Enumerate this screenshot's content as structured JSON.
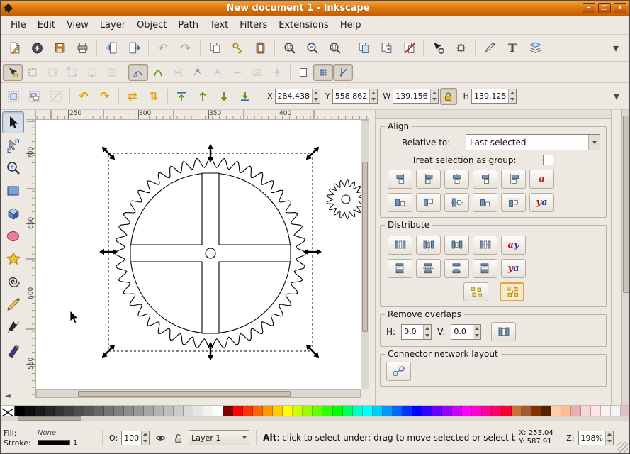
{
  "window": {
    "title": "New document 1 - Inkscape",
    "btn_min": "–",
    "btn_max": "□",
    "btn_close": "×"
  },
  "menubar": [
    "File",
    "Edit",
    "View",
    "Layer",
    "Object",
    "Path",
    "Text",
    "Filters",
    "Extensions",
    "Help"
  ],
  "glyphs": {
    "undo": "↶",
    "redo": "↷",
    "chevron": "▾",
    "rotate_ccw": "↶",
    "rotate_cw": "↷",
    "flip_h": "⇄",
    "flip_v": "⇅",
    "text_tool": "T",
    "collapse": "◄"
  },
  "controls": {
    "x_label": "X",
    "x_value": "284.438",
    "y_label": "Y",
    "y_value": "558.862",
    "w_label": "W",
    "w_value": "139.156",
    "h_label": "H",
    "h_value": "139.125"
  },
  "rulers": {
    "top": [
      "250",
      "300",
      "350",
      "400"
    ],
    "left": [
      "700",
      "650",
      "600",
      "550"
    ]
  },
  "dock": {
    "align": {
      "title": "Align",
      "relative_label": "Relative to:",
      "relative_value": "Last selected",
      "group_label": "Treat selection as group:",
      "text1": "a",
      "text2": "ya"
    },
    "distribute": {
      "title": "Distribute",
      "text1": "ay",
      "text2": "ya"
    },
    "remove": {
      "title": "Remove overlaps",
      "h_label": "H:",
      "h_value": "0.0",
      "v_label": "V:",
      "v_value": "0.0"
    },
    "connector": {
      "title": "Connector network layout"
    }
  },
  "statusbar": {
    "fill_label": "Fill:",
    "fill_value": "None",
    "stroke_label": "Stroke:",
    "stroke_width": "1",
    "opacity_label": "O:",
    "opacity_value": "100",
    "layer_name": "Layer 1",
    "msg_bold": "Alt",
    "msg_rest": ": click to select under; drag to move selected or select by",
    "x_label": "X:",
    "x_value": "253.04",
    "y_label": "Y:",
    "y_value": "587.91",
    "z_label": "Z:",
    "zoom_value": "198%"
  },
  "theme": {
    "titlebar_orange": "#E07B10",
    "chrome": "#EDE9E2",
    "focus_highlight": "#E8A33D",
    "icon_blue": "#7396b8",
    "icon_green": "#4e9a06"
  },
  "palette": {
    "colors": [
      "#000000",
      "#0d0d0d",
      "#1a1a1a",
      "#262626",
      "#333333",
      "#404040",
      "#4d4d4d",
      "#595959",
      "#666666",
      "#737373",
      "#808080",
      "#8c8c8c",
      "#999999",
      "#a6a6a6",
      "#b3b3b3",
      "#bfbfbf",
      "#cccccc",
      "#d9d9d9",
      "#e6e6e6",
      "#f2f2f2",
      "#ffffff",
      "#800000",
      "#ff0000",
      "#ff3300",
      "#ff6600",
      "#ff9900",
      "#ffcc00",
      "#ffff00",
      "#ccff00",
      "#99ff00",
      "#66ff00",
      "#33ff00",
      "#00ff00",
      "#00ff66",
      "#00ffcc",
      "#00ffff",
      "#00ccff",
      "#0099ff",
      "#0066ff",
      "#0033ff",
      "#0000ff",
      "#3300ff",
      "#6600ff",
      "#9900ff",
      "#cc00ff",
      "#ff00ff",
      "#ff00cc",
      "#ff0099",
      "#ff0066",
      "#ff0033",
      "#c87137",
      "#a05a2c",
      "#803300",
      "#552200",
      "#ffccaa",
      "#ffbb99",
      "#e9afaf",
      "#f4d7d7",
      "#ffe6e6",
      "#fff0f5",
      "#f5f5f5",
      "#e0c0c0"
    ]
  }
}
